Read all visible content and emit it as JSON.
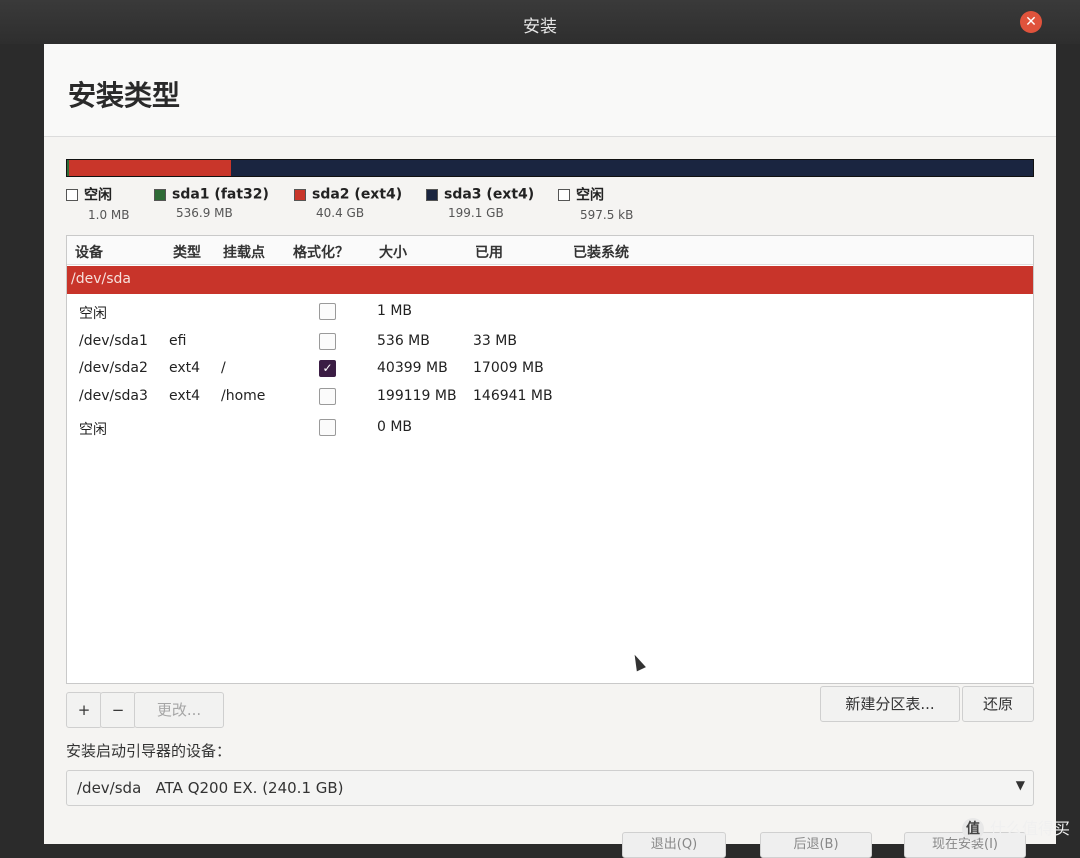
{
  "window": {
    "title": "安装",
    "close_glyph": "✕"
  },
  "page": {
    "title": "安装类型"
  },
  "legend": [
    {
      "name": "空闲",
      "size": "1.0 MB",
      "color": "#ffffff"
    },
    {
      "name": "sda1 (fat32)",
      "size": "536.9 MB",
      "color": "#2e6b36"
    },
    {
      "name": "sda2 (ext4)",
      "size": "40.4 GB",
      "color": "#c9362a"
    },
    {
      "name": "sda3 (ext4)",
      "size": "199.1 GB",
      "color": "#1a2540"
    },
    {
      "name": "空闲",
      "size": "597.5 kB",
      "color": "#ffffff"
    }
  ],
  "table": {
    "headers": {
      "device": "设备",
      "type": "类型",
      "mount": "挂载点",
      "format": "格式化？",
      "size": "大小",
      "used": "已用",
      "system": "已装系统"
    },
    "device_row": "/dev/sda",
    "rows": [
      {
        "device": "空闲",
        "type": "",
        "mount": "",
        "format": false,
        "size": "1 MB",
        "used": ""
      },
      {
        "device": "/dev/sda1",
        "type": "efi",
        "mount": "",
        "format": false,
        "size": "536 MB",
        "used": "33 MB"
      },
      {
        "device": "/dev/sda2",
        "type": "ext4",
        "mount": "/",
        "format": true,
        "size": "40399 MB",
        "used": "17009 MB"
      },
      {
        "device": "/dev/sda3",
        "type": "ext4",
        "mount": "/home",
        "format": false,
        "size": "199119 MB",
        "used": "146941 MB"
      },
      {
        "device": "空闲",
        "type": "",
        "mount": "",
        "format": false,
        "size": "0 MB",
        "used": ""
      }
    ]
  },
  "toolbar": {
    "add": "+",
    "remove": "−",
    "change": "更改...",
    "new_table": "新建分区表...",
    "revert": "还原"
  },
  "boot": {
    "label": "安装启动引导器的设备：",
    "device": "/dev/sda",
    "description": "ATA Q200 EX. (240.1 GB)"
  },
  "footer": {
    "quit": "退出(Q)",
    "back": "后退(B)",
    "install": "现在安装(I)"
  },
  "watermark": {
    "logo": "值",
    "text": "什么值得买"
  },
  "colors": {
    "accent": "#c8342a",
    "checkbox_on": "#3b1d44"
  }
}
